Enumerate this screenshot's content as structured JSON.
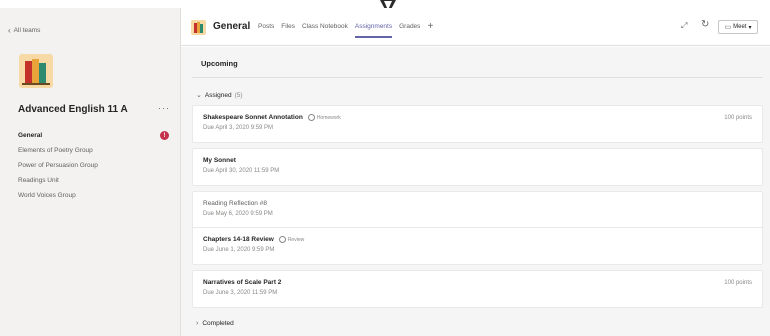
{
  "sidebar": {
    "back_label": "All teams",
    "team_name": "Advanced English 11 A",
    "more_label": "···",
    "channels": [
      {
        "label": "General",
        "alert": "!"
      },
      {
        "label": "Elements of Poetry Group"
      },
      {
        "label": "Power of Persuasion Group"
      },
      {
        "label": "Readings Unit"
      },
      {
        "label": "World Voices Group"
      }
    ]
  },
  "header": {
    "channel_title": "General",
    "tabs": [
      {
        "label": "Posts"
      },
      {
        "label": "Files"
      },
      {
        "label": "Class Notebook"
      },
      {
        "label": "Assignments",
        "active": true
      },
      {
        "label": "Grades"
      }
    ],
    "add_tab": "+",
    "meet_label": "Meet"
  },
  "main": {
    "upcoming_label": "Upcoming",
    "assigned_label": "Assigned",
    "assigned_count": "(5)",
    "completed_label": "Completed",
    "assignments": [
      {
        "title": "Shakespeare Sonnet Annotation",
        "tag": "Homework",
        "due": "Due April 3, 2020 9:59 PM",
        "points": "100 points"
      },
      {
        "title": "My Sonnet",
        "due": "Due April 30, 2020 11:59 PM"
      },
      {
        "title": "Reading Reflection #8",
        "due": "Due May 6, 2020 9:59 PM"
      },
      {
        "title": "Chapters 14-18 Review",
        "tag": "Review",
        "due": "Due June 1, 2020 9:59 PM"
      },
      {
        "title": "Narratives of Scale Part 2",
        "due": "Due June 3, 2020 11:59 PM",
        "points": "100 points"
      }
    ]
  },
  "colors": {
    "accent": "#6264a7",
    "alert": "#c4314b",
    "sidebar_bg": "#f3f2f1",
    "content_bg": "#f5f5f5"
  },
  "icons": [
    "cursor-icon",
    "chevron-left-icon",
    "team-logo",
    "more-icon",
    "alert-icon",
    "add-tab-icon",
    "expand-icon",
    "refresh-icon",
    "video-camera-icon",
    "chevron-down-icon",
    "chevron-right-icon",
    "tag-ring-icon"
  ]
}
